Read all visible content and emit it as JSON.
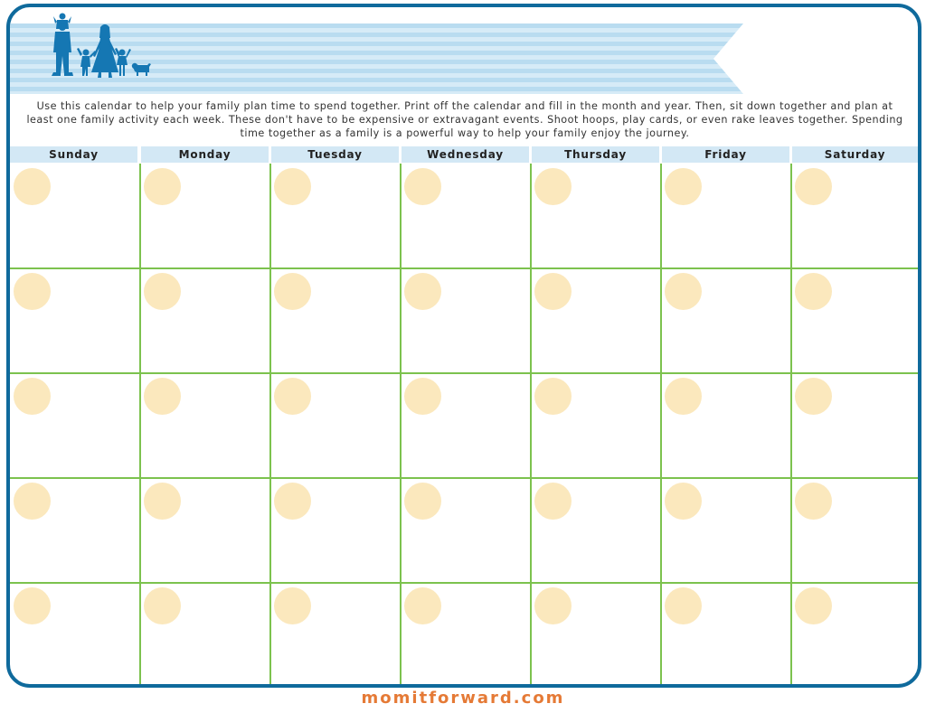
{
  "intro_text": "Use this calendar to help your family plan time to spend together. Print off the calendar and fill in the month and year. Then, sit down together and plan at least one family activity each week. These don't have to be expensive or extravagant events. Shoot hoops, play cards, or even rake leaves together. Spending time together as a family is a powerful way to help your family enjoy the journey.",
  "weekdays": [
    "Sunday",
    "Monday",
    "Tuesday",
    "Wednesday",
    "Thursday",
    "Friday",
    "Saturday"
  ],
  "week_rows": 5,
  "banner_icon": "family-silhouette-icon",
  "colors": {
    "frame": "#0f6a9c",
    "header": "#d3e8f5",
    "grid_lines": "#7cc24e",
    "date_circle": "#fbe8bd",
    "footer": "#e57a36",
    "stripe_dark": "#b9dcf0",
    "stripe_light": "#d6ebf7"
  },
  "footer": "momitforward.com"
}
